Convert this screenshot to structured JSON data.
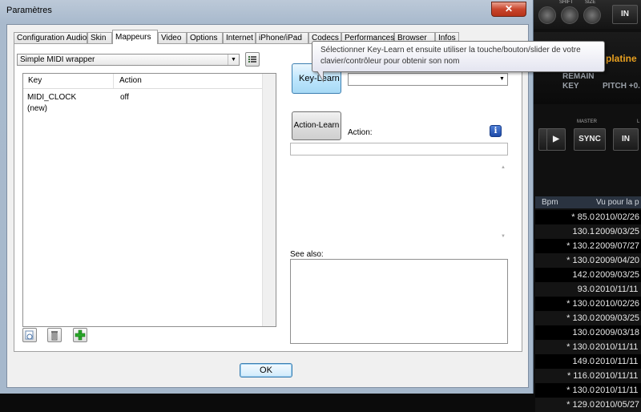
{
  "window": {
    "title": "Paramètres",
    "close_glyph": "✕"
  },
  "tabs": [
    {
      "label": "Configuration Audio"
    },
    {
      "label": "Skin"
    },
    {
      "label": "Mappeurs"
    },
    {
      "label": "Video"
    },
    {
      "label": "Options"
    },
    {
      "label": "Internet"
    },
    {
      "label": "iPhone/iPad"
    },
    {
      "label": "Codecs"
    },
    {
      "label": "Performances"
    },
    {
      "label": "Browser"
    },
    {
      "label": "Infos"
    }
  ],
  "active_tab": "Mappeurs",
  "mapper": {
    "selected": "Simple MIDI wrapper",
    "list_headers": {
      "key": "Key",
      "action": "Action"
    },
    "rows": [
      {
        "key": "MIDI_CLOCK",
        "action": "off"
      },
      {
        "key": "(new)",
        "action": ""
      }
    ]
  },
  "right_panel": {
    "key_learn_label": "Key-Learn",
    "action_learn_label": "Action-Learn",
    "action_label": "Action:",
    "see_also_label": "See also:",
    "info_glyph": "i"
  },
  "tooltip": {
    "line1": "Sélectionner Key-Learn et ensuite utiliser la touche/bouton/slider de votre",
    "line2": "clavier/contrôleur pour obtenir son nom"
  },
  "footer": {
    "ok_label": "OK"
  },
  "background_app": {
    "knob_labels": [
      "SHIFT",
      "SIZE"
    ],
    "in_label": "IN",
    "platine_label": "platine",
    "remain_label": "REMAIN",
    "key_label": "KEY",
    "pitch_label": "PITCH +0.",
    "master_label": "MASTER",
    "l_label": "L",
    "play_glyph": "▶",
    "sync_label": "SYNC",
    "table_headers": {
      "bpm": "Bpm",
      "date": "Vu pour la p"
    },
    "rows": [
      {
        "bpm": "* 85.0",
        "date": "2010/02/26"
      },
      {
        "bpm": "130.1",
        "date": "2009/03/25"
      },
      {
        "bpm": "* 130.2",
        "date": "2009/07/27"
      },
      {
        "bpm": "* 130.0",
        "date": "2009/04/20"
      },
      {
        "bpm": "142.0",
        "date": "2009/03/25"
      },
      {
        "bpm": "93.0",
        "date": "2010/11/11"
      },
      {
        "bpm": "* 130.0",
        "date": "2010/02/26"
      },
      {
        "bpm": "* 130.0",
        "date": "2009/03/25"
      },
      {
        "bpm": "130.0",
        "date": "2009/03/18"
      },
      {
        "bpm": "* 130.0",
        "date": "2010/11/11"
      },
      {
        "bpm": "149.0",
        "date": "2010/11/11"
      },
      {
        "bpm": "* 116.0",
        "date": "2010/11/11"
      },
      {
        "bpm": "* 130.0",
        "date": "2010/11/11"
      },
      {
        "bpm": "* 129.0",
        "date": "2010/05/27"
      }
    ]
  },
  "icons": {
    "list_icon": "list-icon",
    "load_icon": "load-icon",
    "delete_icon": "trash-icon",
    "add_icon": "add-icon"
  },
  "colors": {
    "title_gradient": "#bcc9d8",
    "close_red": "#c9452c",
    "key_learn_blue": "#bee6fd",
    "add_green": "#2aa82a",
    "bg_orange": "#e8a020"
  }
}
